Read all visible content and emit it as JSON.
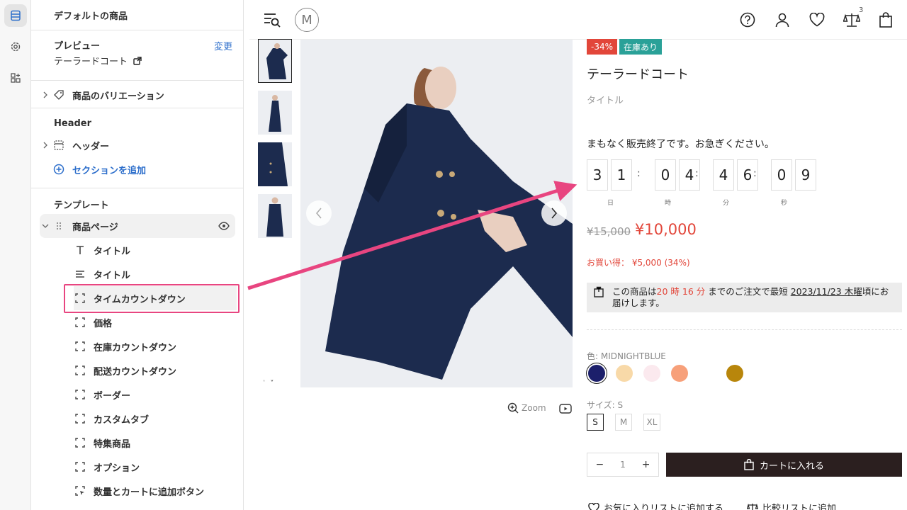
{
  "sidebar": {
    "title": "デフォルトの商品",
    "preview_label": "プレビュー",
    "preview_change": "変更",
    "preview_value": "テーラードコート",
    "variation_label": "商品のバリエーション",
    "header_section_label": "Header",
    "header_item": "ヘッダー",
    "add_section": "セクションを追加",
    "template_label": "テンプレート",
    "page_item": "商品ページ",
    "blocks": [
      {
        "label": "タイトル",
        "icon": "text-icon"
      },
      {
        "label": "タイトル",
        "icon": "align-left-icon"
      },
      {
        "label": "タイムカウントダウン",
        "icon": "block-icon"
      },
      {
        "label": "価格",
        "icon": "block-icon"
      },
      {
        "label": "在庫カウントダウン",
        "icon": "block-icon"
      },
      {
        "label": "配送カウントダウン",
        "icon": "block-icon"
      },
      {
        "label": "ボーダー",
        "icon": "block-icon"
      },
      {
        "label": "カスタムタブ",
        "icon": "block-icon"
      },
      {
        "label": "特集商品",
        "icon": "block-icon"
      },
      {
        "label": "オプション",
        "icon": "block-icon"
      },
      {
        "label": "数量とカートに追加ボタン",
        "icon": "block-cursor-icon"
      }
    ]
  },
  "store": {
    "logo_letter": "M",
    "compare_count": "3"
  },
  "product": {
    "badge_discount": "-34%",
    "badge_stock": "在庫あり",
    "title": "テーラードコート",
    "subtitle": "タイトル",
    "hurry_text": "まもなく販売終了です。お急ぎください。",
    "countdown": {
      "digits": [
        "3",
        "1",
        "0",
        "4",
        "4",
        "6",
        "0",
        "9"
      ],
      "units": [
        "日",
        "時",
        "分",
        "秒"
      ],
      "separator": ":"
    },
    "old_price": "¥15,000",
    "new_price": "¥10,000",
    "save_text": "お買い得： ¥5,000 (34%)",
    "delivery": {
      "part1": "この商品は",
      "time": "20 時 16 分",
      "part2": " までのご注文で最短 ",
      "date": "2023/11/23 木曜",
      "part3": "頃にお届けします。"
    },
    "color_label": "色: MIDNIGHTBLUE",
    "size_label": "サイズ: S",
    "sizes": [
      "S",
      "M",
      "XL"
    ],
    "quantity": "1",
    "qty_minus": "−",
    "qty_plus": "+",
    "add_to_cart": "カートに入れる",
    "zoom_label": "Zoom",
    "wishlist": "お気に入りリストに追加する",
    "compare": "比較リストに追加"
  },
  "colors": {
    "accent_pink": "#e84580",
    "discount_red": "#e2463a",
    "stock_teal": "#2aa198",
    "swatches": [
      "#1c1f6b",
      "#f8d9a8",
      "#fbe9ee",
      "#f7a07a",
      "#ffffff",
      "#b8860b"
    ]
  }
}
